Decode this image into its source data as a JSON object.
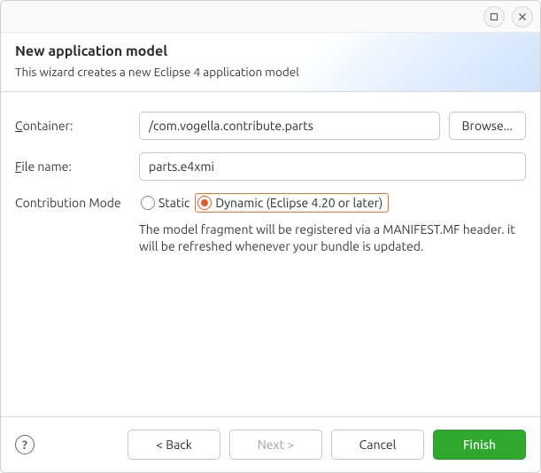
{
  "window": {
    "title": "New application model",
    "subtitle": "This wizard creates a new Eclipse 4 application model"
  },
  "form": {
    "container_label": "Container:",
    "container_value": "/com.vogella.contribute.parts",
    "browse_label": "Browse...",
    "filename_label": "File name:",
    "filename_value": "parts.e4xmi",
    "mode_label": "Contribution Mode",
    "mode_static_label": "Static",
    "mode_dynamic_label": "Dynamic (Eclipse 4.20 or later)",
    "mode_desc": "The model fragment will be registered via a MANIFEST.MF header. it will be refreshed whenever your bundle is updated."
  },
  "footer": {
    "back": "< Back",
    "next": "Next >",
    "cancel": "Cancel",
    "finish": "Finish"
  }
}
